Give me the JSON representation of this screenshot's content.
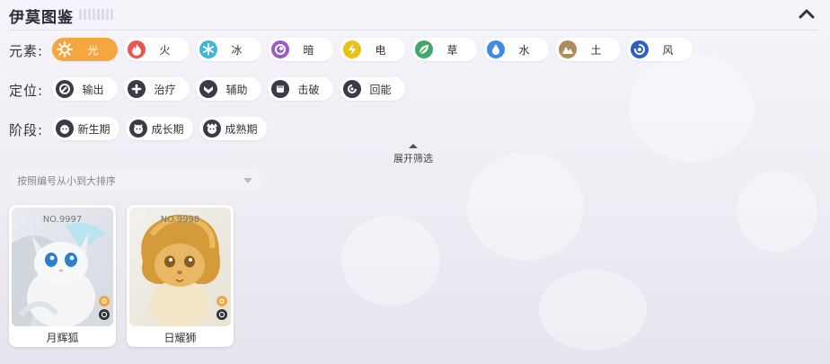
{
  "header": {
    "title": "伊莫图鉴"
  },
  "filters": {
    "element": {
      "label": "元素:",
      "options": [
        {
          "label": "光",
          "icon": "sun-icon",
          "color": "#f5a63c",
          "active": true
        },
        {
          "label": "火",
          "icon": "flame-icon",
          "color": "#e8564d"
        },
        {
          "label": "冰",
          "icon": "snowflake-icon",
          "color": "#3fb8d8"
        },
        {
          "label": "暗",
          "icon": "dark-swirl-icon",
          "color": "#9a5cc6"
        },
        {
          "label": "电",
          "icon": "lightning-icon",
          "color": "#e6c21a"
        },
        {
          "label": "草",
          "icon": "leaf-icon",
          "color": "#3fa86a"
        },
        {
          "label": "水",
          "icon": "water-drop-icon",
          "color": "#3d8ee0"
        },
        {
          "label": "土",
          "icon": "mountain-icon",
          "color": "#b08a5a"
        },
        {
          "label": "风",
          "icon": "wind-swirl-icon",
          "color": "#2f5fc0"
        }
      ]
    },
    "role": {
      "label": "定位:",
      "options": [
        {
          "label": "输出",
          "icon": "damage-icon"
        },
        {
          "label": "治疗",
          "icon": "heal-cross-icon"
        },
        {
          "label": "辅助",
          "icon": "support-icon"
        },
        {
          "label": "击破",
          "icon": "fist-icon"
        },
        {
          "label": "回能",
          "icon": "energy-recharge-icon"
        }
      ]
    },
    "stage": {
      "label": "阶段:",
      "options": [
        {
          "label": "新生期",
          "icon": "newborn-face-icon"
        },
        {
          "label": "成长期",
          "icon": "growth-face-icon"
        },
        {
          "label": "成熟期",
          "icon": "mature-face-icon"
        }
      ]
    },
    "expand_label": "展开筛选"
  },
  "sort": {
    "placeholder": "按照编号从小到大排序"
  },
  "cards": [
    {
      "number": "NO.9997",
      "name": "月辉狐"
    },
    {
      "number": "NO.9998",
      "name": "日耀狮"
    }
  ]
}
